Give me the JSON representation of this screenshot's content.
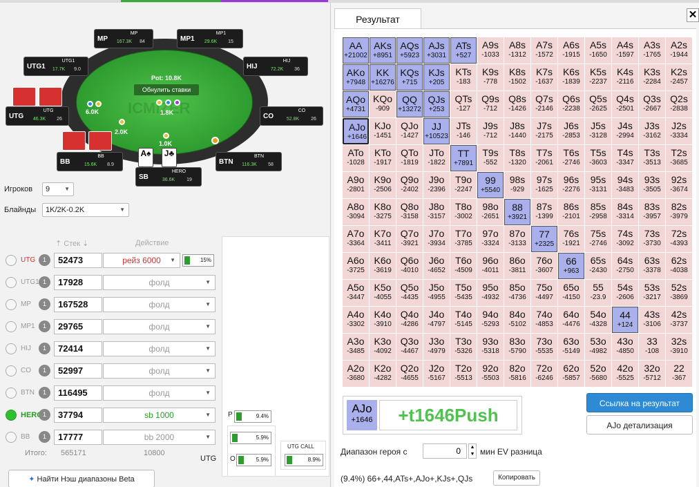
{
  "table": {
    "pot": "Pot: 10.8K",
    "reset": "Обнулить ставки",
    "watermark": "ICMIZER",
    "seats": {
      "mp": {
        "pos": "MP",
        "name": "MP",
        "stack": "167.3K",
        "bb": "84"
      },
      "mp1": {
        "pos": "MP1",
        "name": "MP1",
        "stack": "29.6K",
        "bb": "15"
      },
      "utg1": {
        "pos": "UTG1",
        "name": "UTG1",
        "stack": "17.7K",
        "bb": "9.0"
      },
      "hij": {
        "pos": "HIJ",
        "name": "HIJ",
        "stack": "72.2K",
        "bb": "36"
      },
      "utg": {
        "pos": "UTG",
        "name": "UTG",
        "stack": "46.3K",
        "bb": "26"
      },
      "co": {
        "pos": "CO",
        "name": "CO",
        "stack": "52.8K",
        "bb": "26"
      },
      "bb": {
        "pos": "BB",
        "name": "BB",
        "stack": "15.6K",
        "bb": "8.9"
      },
      "btn": {
        "pos": "BTN",
        "name": "BTN",
        "stack": "116.3K",
        "bb": "58"
      },
      "sb": {
        "pos": "SB",
        "name": "HERO",
        "stack": "36.6K",
        "bb": "19"
      }
    },
    "bets": {
      "utg": "6.0K",
      "mid": "1.8K",
      "bb": "2.0K",
      "sb": "1.0K"
    },
    "hero_cards": [
      "A♠",
      "J♣"
    ]
  },
  "controls": {
    "players_label": "Игроков",
    "players_value": "9",
    "blinds_label": "Блайнды",
    "blinds_value": "1K/2K-0.2K"
  },
  "headers": {
    "stack": "Стек",
    "action": "Действие"
  },
  "players": [
    {
      "pos": "UTG",
      "num": "1",
      "stack": "52473",
      "action": "рейз 6000",
      "pct": "15%"
    },
    {
      "pos": "UTG1",
      "num": "1",
      "stack": "17928",
      "action": "фолд"
    },
    {
      "pos": "MP",
      "num": "1",
      "stack": "167528",
      "action": "фолд"
    },
    {
      "pos": "MP1",
      "num": "1",
      "stack": "29765",
      "action": "фолд"
    },
    {
      "pos": "HIJ",
      "num": "1",
      "stack": "72414",
      "action": "фолд"
    },
    {
      "pos": "CO",
      "num": "1",
      "stack": "52997",
      "action": "фолд"
    },
    {
      "pos": "BTN",
      "num": "1",
      "stack": "116495",
      "action": "фолд"
    },
    {
      "pos": "HERO",
      "num": "1",
      "stack": "37794",
      "action": "sb 1000"
    },
    {
      "pos": "BB",
      "num": "1",
      "stack": "17777",
      "action": "bb 2000"
    }
  ],
  "totals": {
    "label": "Итого:",
    "stack": "565171",
    "action": "10800"
  },
  "summary": {
    "p_label": "P",
    "p_pct": "9.4%",
    "mid_pct": "5.9%",
    "utg_label": "UTG",
    "o_label": "O",
    "o_pct": "5.9%",
    "utgcall_label": "UTG CALL",
    "utgcall_pct": "8.9%"
  },
  "nash_button": "Найти Нэш диапазоны Beta",
  "result": {
    "tab": "Результат",
    "close": "✕",
    "grid": [
      [
        "AA|+21002|p",
        "AKs|+8951|p",
        "AQs|+5923|p",
        "AJs|+3031|p",
        "ATs|+527|p",
        "A9s|-1033",
        "A8s|-1312",
        "A7s|-1572",
        "A6s|-1915",
        "A5s|-1650",
        "A4s|-1597",
        "A3s|-1765",
        "A2s|-1944"
      ],
      [
        "AKo|+7948|p",
        "KK|+16276|p",
        "KQs|+715|p",
        "KJs|+205|p",
        "KTs|-183",
        "K9s|-778",
        "K8s|-1502",
        "K7s|-1637",
        "K6s|-1839",
        "K5s|-2237",
        "K4s|-2116",
        "K3s|-2284",
        "K2s|-2457"
      ],
      [
        "AQo|+4731|p",
        "KQo|-909",
        "QQ|+13272|p",
        "QJs|+253|p",
        "QTs|-127",
        "Q9s|-712",
        "Q8s|-1426",
        "Q7s|-2146",
        "Q6s|-2238",
        "Q5s|-2625",
        "Q4s|-2501",
        "Q3s|-2667",
        "Q2s|-2838"
      ],
      [
        "AJo|+1646|s",
        "KJo|-1451",
        "QJo|-1427",
        "JJ|+10523|p",
        "JTs|-146",
        "J9s|-712",
        "J8s|-1440",
        "J7s|-2175",
        "J6s|-2853",
        "J5s|-3128",
        "J4s|-2994",
        "J3s|-3162",
        "J2s|-3334"
      ],
      [
        "ATo|-1028",
        "KTo|-1917",
        "QTo|-1819",
        "JTo|-1822",
        "TT|+7891|p",
        "T9s|-552",
        "T8s|-1320",
        "T7s|-2061",
        "T6s|-2746",
        "T5s|-3603",
        "T4s|-3347",
        "T3s|-3513",
        "T2s|-3685"
      ],
      [
        "A9o|-2801",
        "K9o|-2506",
        "Q9o|-2402",
        "J9o|-2396",
        "T9o|-2247",
        "99|+5540|p",
        "98s|-929",
        "97s|-1625",
        "96s|-2276",
        "95s|-3131",
        "94s|-3483",
        "93s|-3505",
        "92s|-3674"
      ],
      [
        "A8o|-3094",
        "K8o|-3275",
        "Q8o|-3158",
        "J8o|-3157",
        "T8o|-3002",
        "98o|-2651",
        "88|+3921|p",
        "87s|-1399",
        "86s|-2101",
        "85s|-2958",
        "84s|-3314",
        "83s|-3957",
        "82s|-3979"
      ],
      [
        "A7o|-3364",
        "K7o|-3411",
        "Q7o|-3921",
        "J7o|-3934",
        "T7o|-3785",
        "97o|-3324",
        "87o|-3133",
        "77|+2325|p",
        "76s|-1921",
        "75s|-2746",
        "74s|-3092",
        "73s|-3730",
        "72s|-4393"
      ],
      [
        "A6o|-3725",
        "K6o|-3619",
        "Q6o|-4010",
        "J6o|-4652",
        "T6o|-4509",
        "96o|-4011",
        "86o|-3811",
        "76o|-3607",
        "66|+963|p",
        "65s|-2430",
        "64s|-2750",
        "63s|-3378",
        "62s|-4038"
      ],
      [
        "A5o|-3447",
        "K5o|-4055",
        "Q5o|-4435",
        "J5o|-4955",
        "T5o|-5435",
        "95o|-4932",
        "85o|-4736",
        "75o|-4497",
        "65o|-4150",
        "55|-23.9",
        "54s|-2606",
        "53s|-3217",
        "52s|-3869"
      ],
      [
        "A4o|-3302",
        "K4o|-3910",
        "Q4o|-4286",
        "J4o|-4797",
        "T4o|-5145",
        "94o|-5293",
        "84o|-5102",
        "74o|-4853",
        "64o|-4476",
        "54o|-4328",
        "44|+124|p",
        "43s|-3106",
        "42s|-3737"
      ],
      [
        "A3o|-3485",
        "K3o|-4092",
        "Q3o|-4467",
        "J3o|-4979",
        "T3o|-5326",
        "93o|-5318",
        "83o|-5790",
        "73o|-5535",
        "63o|-5149",
        "53o|-4982",
        "43o|-4850",
        "33|-108",
        "32s|-3910"
      ],
      [
        "A2o|-3680",
        "K2o|-4282",
        "Q2o|-4655",
        "J2o|-5167",
        "T2o|-5513",
        "92o|-5503",
        "82o|-5816",
        "72o|-6246",
        "62o|-5857",
        "52o|-5680",
        "42o|-5525",
        "32o|-5712",
        "22|-367"
      ]
    ],
    "selected_hand": "AJo",
    "selected_ev": "+1646",
    "selected_result": "+t1646Push",
    "link_button": "Ссылка на результат",
    "detail_button": "AJo детализация",
    "range_label": "Диапазон героя с",
    "range_value": "0",
    "range_suffix": "мин EV разница",
    "range_text": "(9.4%) 66+,44,ATs+,AJo+,KJs+,QJs",
    "copy_button": "Копировать"
  }
}
